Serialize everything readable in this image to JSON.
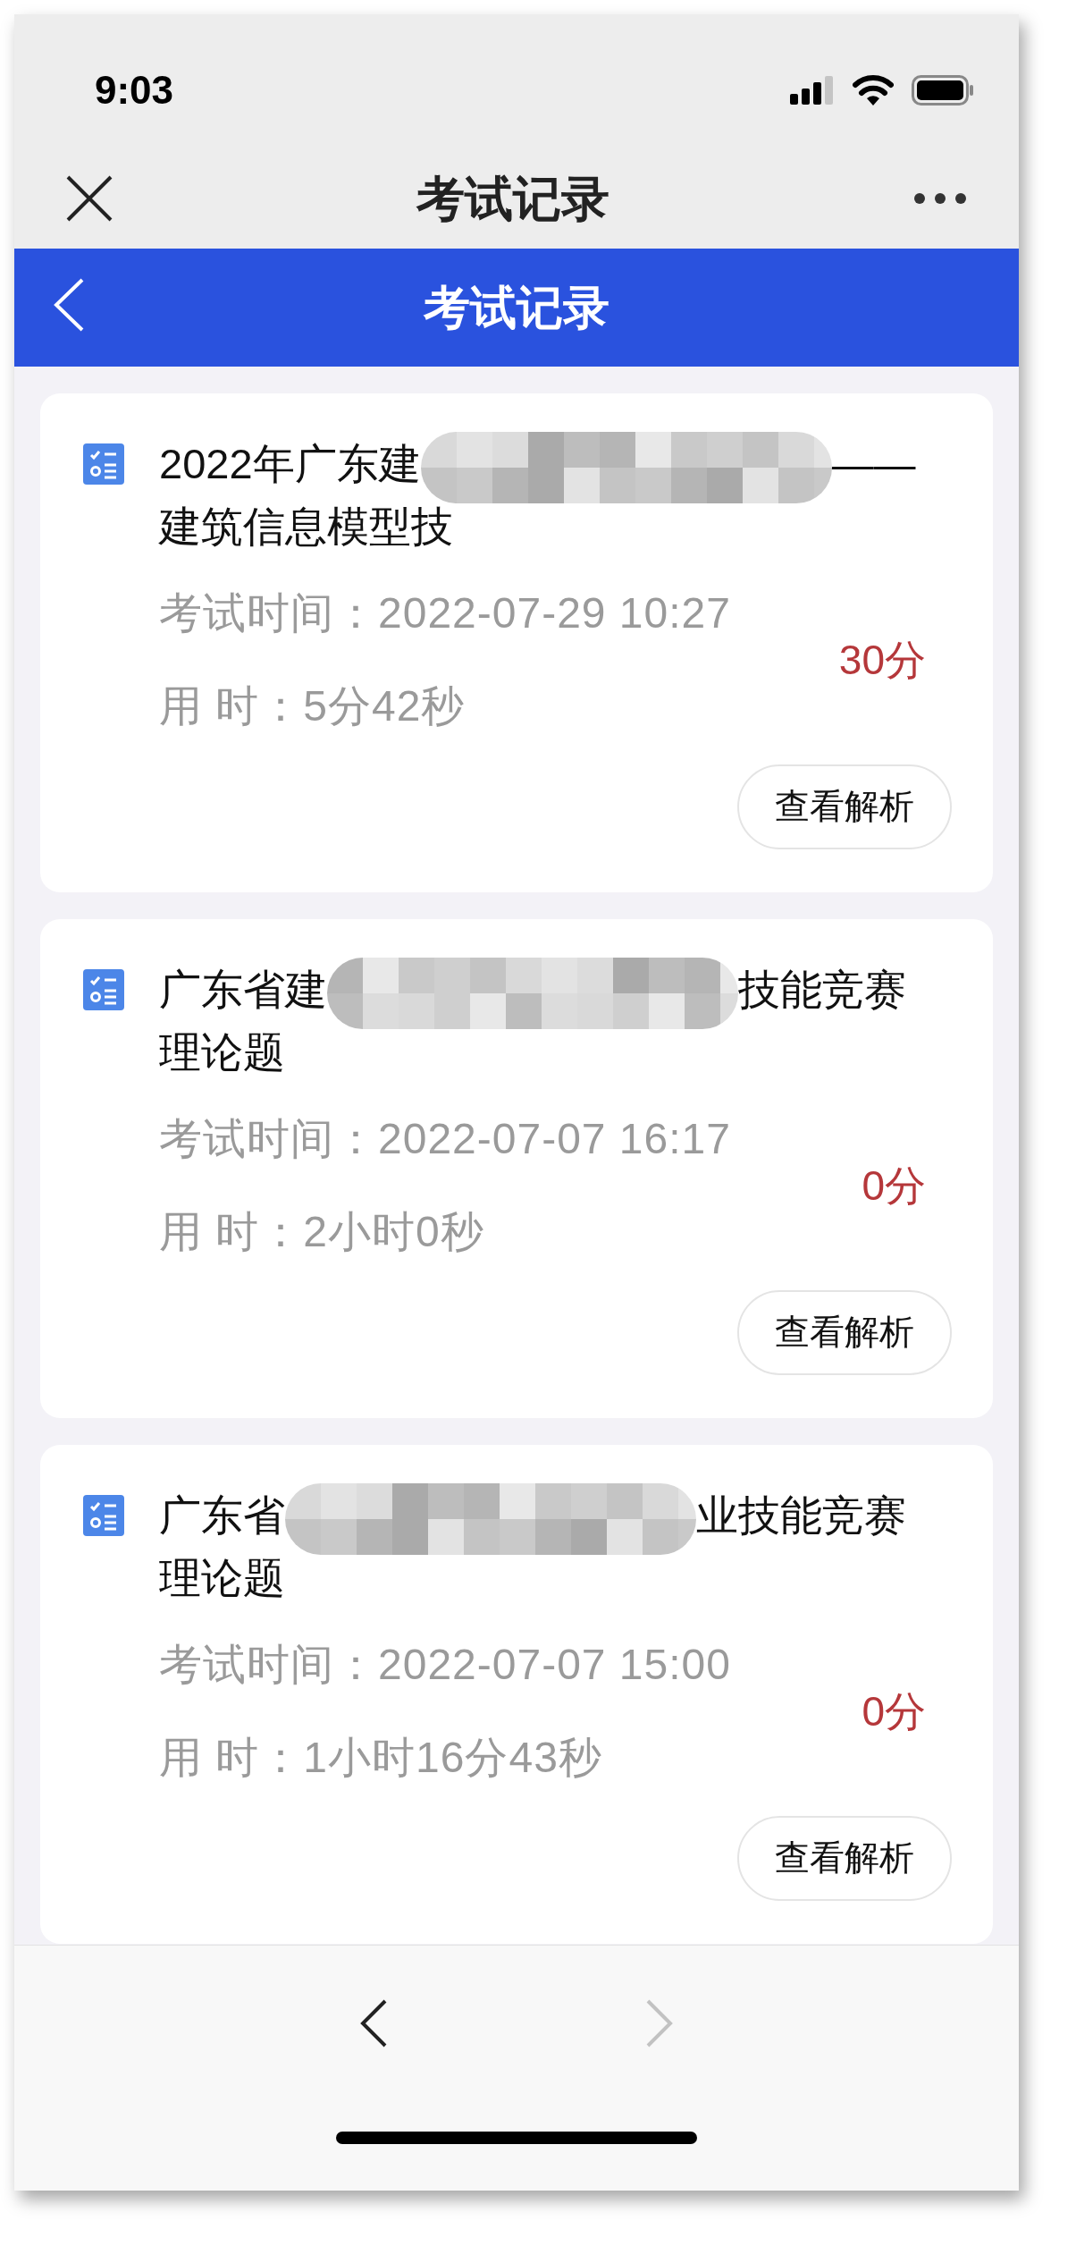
{
  "status_bar": {
    "time": "9:03"
  },
  "nav_bar": {
    "title": "考试记录"
  },
  "header": {
    "title": "考试记录"
  },
  "records": [
    {
      "title_lines": [
        [
          {
            "kind": "text",
            "text": "2022年广东建"
          },
          {
            "kind": "redacted"
          },
          {
            "kind": "text",
            "text": "——"
          }
        ],
        [
          {
            "kind": "text",
            "text": "建筑信息模型技"
          }
        ]
      ],
      "time_label": "考试时间：",
      "time": "2022-07-29 10:27",
      "duration_label": "用 时：",
      "duration": "5分42秒",
      "score": "30分",
      "action": "查看解析"
    },
    {
      "title_lines": [
        [
          {
            "kind": "text",
            "text": "广东省建"
          },
          {
            "kind": "redacted"
          },
          {
            "kind": "text",
            "text": "技能竞赛"
          }
        ],
        [
          {
            "kind": "text",
            "text": "理论题"
          }
        ]
      ],
      "time_label": "考试时间：",
      "time": "2022-07-07 16:17",
      "duration_label": "用 时：",
      "duration": "2小时0秒",
      "score": "0分",
      "action": "查看解析"
    },
    {
      "title_lines": [
        [
          {
            "kind": "text",
            "text": "广东省"
          },
          {
            "kind": "redacted"
          },
          {
            "kind": "text",
            "text": "业技能竞赛"
          }
        ],
        [
          {
            "kind": "text",
            "text": "理论题"
          }
        ]
      ],
      "time_label": "考试时间：",
      "time": "2022-07-07 15:00",
      "duration_label": "用 时：",
      "duration": "1小时16分43秒",
      "score": "0分",
      "action": "查看解析"
    }
  ],
  "bottom_nav": {
    "back": {
      "disabled": false
    },
    "forward": {
      "disabled": true
    }
  }
}
